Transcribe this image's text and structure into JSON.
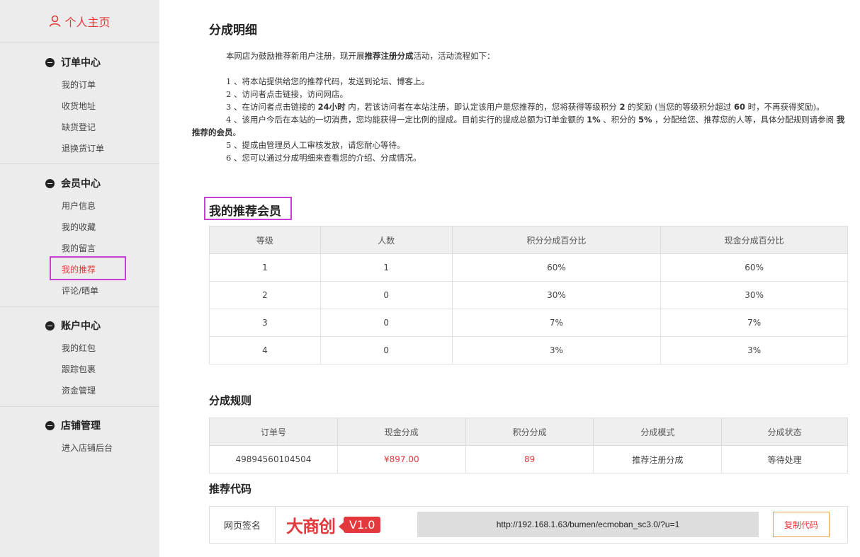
{
  "sidebar": {
    "home_label": "个人主页",
    "groups": [
      {
        "title": "订单中心",
        "items": [
          "我的订单",
          "收货地址",
          "缺货登记",
          "退换货订单"
        ]
      },
      {
        "title": "会员中心",
        "items": [
          "用户信息",
          "我的收藏",
          "我的留言",
          "我的推荐",
          "评论/晒单"
        ]
      },
      {
        "title": "账户中心",
        "items": [
          "我的红包",
          "跟踪包裹",
          "资金管理"
        ]
      },
      {
        "title": "店铺管理",
        "items": [
          "进入店铺后台"
        ]
      }
    ],
    "active_item": "我的推荐"
  },
  "main": {
    "title": "分成明细",
    "intro": {
      "p1_a": "本网店为鼓励推荐新用户注册，现开展",
      "p1_b": "推荐注册分成",
      "p1_c": "活动，活动流程如下：",
      "l1": "1 、将本站提供给您的推荐代码，发送到论坛、博客上。",
      "l2": "2 、访问者点击链接，访问网店。",
      "l3_a": "3 、在访问者点击链接的 ",
      "l3_b": "24小时",
      "l3_c": " 内，若该访问者在本站注册，即认定该用户是您推荐的，您将获得等级积分 ",
      "l3_d": "2",
      "l3_e": " 的奖励 (当您的等级积分超过 ",
      "l3_f": "60",
      "l3_g": " 时，不再获得奖励)。",
      "l4_a": "4 、该用户今后在本站的一切消费，您均能获得一定比例的提成。目前实行的提成总额为订单金额的 ",
      "l4_b": "1%",
      "l4_c": " 、积分的 ",
      "l4_d": "5%",
      "l4_e": " ，分配给您、推荐您的人等，具体分配规则请参阅 ",
      "l4_f": "我推荐的会员",
      "l4_g": "。",
      "l5": "5 、提成由管理员人工审核发放，请您耐心等待。",
      "l6": "6 、您可以通过分成明细来查看您的介绍、分成情况。"
    },
    "members": {
      "title": "我的推荐会员",
      "headers": [
        "等级",
        "人数",
        "积分分成百分比",
        "现金分成百分比"
      ],
      "rows": [
        [
          "1",
          "1",
          "60%",
          "60%"
        ],
        [
          "2",
          "0",
          "30%",
          "30%"
        ],
        [
          "3",
          "0",
          "7%",
          "7%"
        ],
        [
          "4",
          "0",
          "3%",
          "3%"
        ]
      ]
    },
    "rules": {
      "title": "分成规则",
      "headers": [
        "订单号",
        "现金分成",
        "积分分成",
        "分成模式",
        "分成状态"
      ],
      "rows": [
        [
          "49894560104504",
          "¥897.00",
          "89",
          "推荐注册分成",
          "等待处理"
        ]
      ]
    },
    "code": {
      "title": "推荐代码",
      "label": "网页签名",
      "logo_text": "大商创",
      "logo_version": "V1.0",
      "url": "http://192.168.1.63/bumen/ecmoban_sc3.0/?u=1",
      "copy_label": "复制代码"
    }
  },
  "colors": {
    "accent": "#e4393c",
    "highlight": "#c63fd0",
    "sidebar_bg": "#ececec"
  }
}
